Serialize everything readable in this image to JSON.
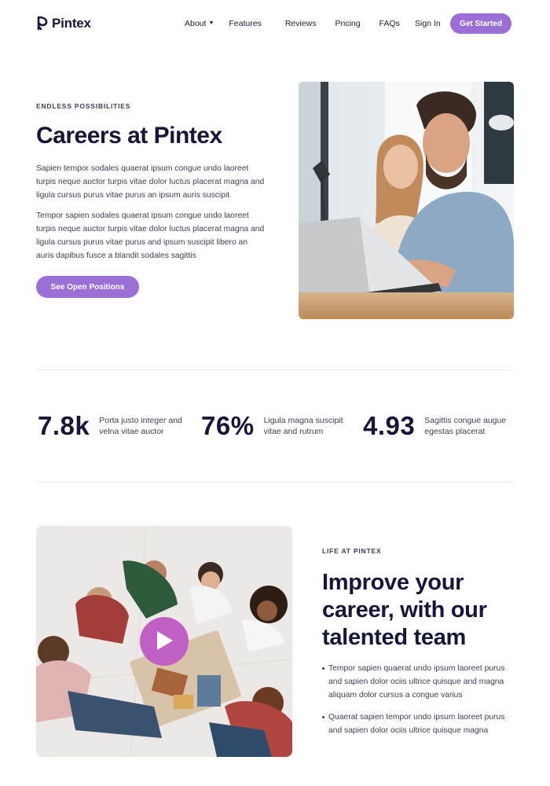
{
  "brand": {
    "name": "Pintex",
    "logo_icon": "pintex-logo-icon"
  },
  "nav": {
    "items": [
      {
        "label": "About",
        "has_dropdown": true
      },
      {
        "label": "Features"
      },
      {
        "label": "Reviews"
      },
      {
        "label": "Pricing"
      },
      {
        "label": "FAQs"
      }
    ],
    "sign_in": "Sign In",
    "cta": "Get Started"
  },
  "hero": {
    "eyebrow": "ENDLESS POSSIBILITIES",
    "title": "Careers at Pintex",
    "paragraph1": "Sapien tempor sodales quaerat ipsum congue undo laoreet turpis neque auctor turpis vitae dolor luctus placerat magna and ligula cursus purus vitae purus an ipsum auris suscipit",
    "paragraph2": "Tempor sapien sodales quaerat ipsum congue undo laoreet turpis neque auctor turpis vitae dolor luctus placerat magna and ligula cursus purus vitae purus and ipsum suscipit libero an auris dapibus fusce a blandit sodales sagittis",
    "button": "See Open Positions",
    "image": "two-people-working-on-laptop-photo"
  },
  "stats": [
    {
      "value": "7.8k",
      "label": "Porta justo integer and velna vitae auctor"
    },
    {
      "value": "76%",
      "label": "Ligula magna suscipit vitae and rutrum"
    },
    {
      "value": "4.93",
      "label": "Sagittis congue augue egestas placerat"
    }
  ],
  "life": {
    "eyebrow": "LIFE AT PINTEX",
    "title": "Improve your career, with our talented team",
    "bullets": [
      "Tempor sapien quaerat undo ipsum laoreet purus and sapien dolor ociis ultrice quisque and magna aliquam dolor cursus a congue varius",
      "Quaerat sapien tempor undo ipsum laoreet purus and sapien dolor ociis ultrice quisque magna"
    ],
    "image": "team-sitting-in-circle-photo",
    "play_icon": "play-icon"
  },
  "colors": {
    "accent": "#9b6fd6",
    "play": "#c060c4",
    "heading": "#15163a",
    "body": "#3d3e55"
  }
}
